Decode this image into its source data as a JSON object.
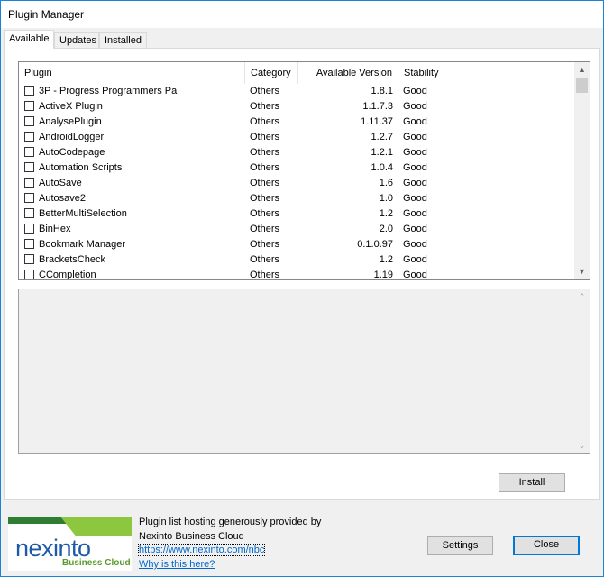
{
  "window": {
    "title": "Plugin Manager"
  },
  "tabs": [
    {
      "label": "Available",
      "active": true
    },
    {
      "label": "Updates",
      "active": false
    },
    {
      "label": "Installed",
      "active": false
    }
  ],
  "plugin_list": {
    "columns": [
      "Plugin",
      "Category",
      "Available Version",
      "Stability"
    ],
    "rows": [
      {
        "name": "3P - Progress Programmers Pal",
        "category": "Others",
        "version": "1.8.1",
        "stability": "Good"
      },
      {
        "name": "ActiveX Plugin",
        "category": "Others",
        "version": "1.1.7.3",
        "stability": "Good"
      },
      {
        "name": "AnalysePlugin",
        "category": "Others",
        "version": "1.11.37",
        "stability": "Good"
      },
      {
        "name": "AndroidLogger",
        "category": "Others",
        "version": "1.2.7",
        "stability": "Good"
      },
      {
        "name": "AutoCodepage",
        "category": "Others",
        "version": "1.2.1",
        "stability": "Good"
      },
      {
        "name": "Automation Scripts",
        "category": "Others",
        "version": "1.0.4",
        "stability": "Good"
      },
      {
        "name": "AutoSave",
        "category": "Others",
        "version": "1.6",
        "stability": "Good"
      },
      {
        "name": "Autosave2",
        "category": "Others",
        "version": "1.0",
        "stability": "Good"
      },
      {
        "name": "BetterMultiSelection",
        "category": "Others",
        "version": "1.2",
        "stability": "Good"
      },
      {
        "name": "BinHex",
        "category": "Others",
        "version": "2.0",
        "stability": "Good"
      },
      {
        "name": "Bookmark Manager",
        "category": "Others",
        "version": "0.1.0.97",
        "stability": "Good"
      },
      {
        "name": "BracketsCheck",
        "category": "Others",
        "version": "1.2",
        "stability": "Good"
      },
      {
        "name": "CCompletion",
        "category": "Others",
        "version": "1.19",
        "stability": "Good"
      }
    ]
  },
  "buttons": {
    "install": "Install",
    "settings": "Settings",
    "close": "Close"
  },
  "footer": {
    "logo_text": "nexinto",
    "logo_subtext": "Business Cloud",
    "line1": "Plugin list hosting generously provided by",
    "line2": "Nexinto Business Cloud",
    "link_url": "https://www.nexinto.com/nbc",
    "link_why": "Why is this here?"
  },
  "icons": {
    "scroll_up": "scroll-up-arrow-icon",
    "scroll_down": "scroll-down-arrow-icon"
  }
}
